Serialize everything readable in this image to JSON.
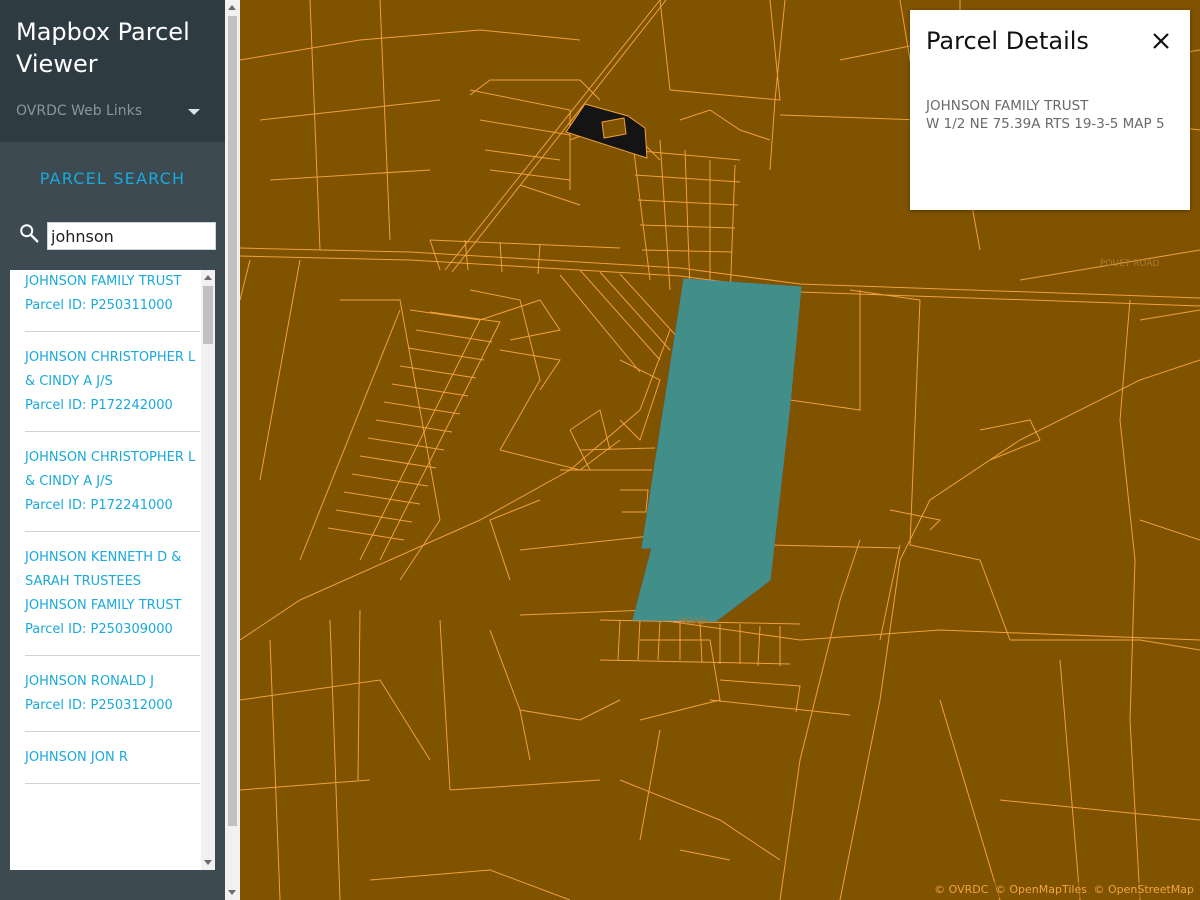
{
  "app": {
    "title": "Mapbox Parcel Viewer"
  },
  "sidebar": {
    "weblinks_label": "OVRDC Web Links",
    "search_heading": "PARCEL SEARCH",
    "search_value": "johnson",
    "results": [
      {
        "name": "JOHNSON FAMILY TRUST",
        "parcel_id": "Parcel ID: P250311000"
      },
      {
        "name": "JOHNSON CHRISTOPHER L & CINDY A J/S",
        "parcel_id": "Parcel ID: P172242000"
      },
      {
        "name": "JOHNSON CHRISTOPHER L & CINDY A J/S",
        "parcel_id": "Parcel ID: P172241000"
      },
      {
        "name": "JOHNSON KENNETH D & SARAH TRUSTEES JOHNSON FAMILY TRUST",
        "parcel_id": "Parcel ID: P250309000"
      },
      {
        "name": "JOHNSON RONALD J",
        "parcel_id": "Parcel ID: P250312000"
      },
      {
        "name": "JOHNSON JON R",
        "parcel_id": ""
      }
    ]
  },
  "details": {
    "title": "Parcel Details",
    "owner": "JOHNSON FAMILY TRUST",
    "description": "W 1/2 NE 75.39A RTS 19-3-5 MAP 5"
  },
  "map": {
    "road_labels": [
      "POUET ROAD",
      "ROAD"
    ],
    "colors": {
      "background": "#7f5300",
      "parcel_line": "#f0a03c",
      "selected_fill": "#428f8a",
      "highlight_fill": "#141414"
    }
  },
  "attribution": {
    "ovrdc": "© OVRDC",
    "openmaptiles": "© OpenMapTiles",
    "openstreetmap": "© OpenStreetMap"
  }
}
